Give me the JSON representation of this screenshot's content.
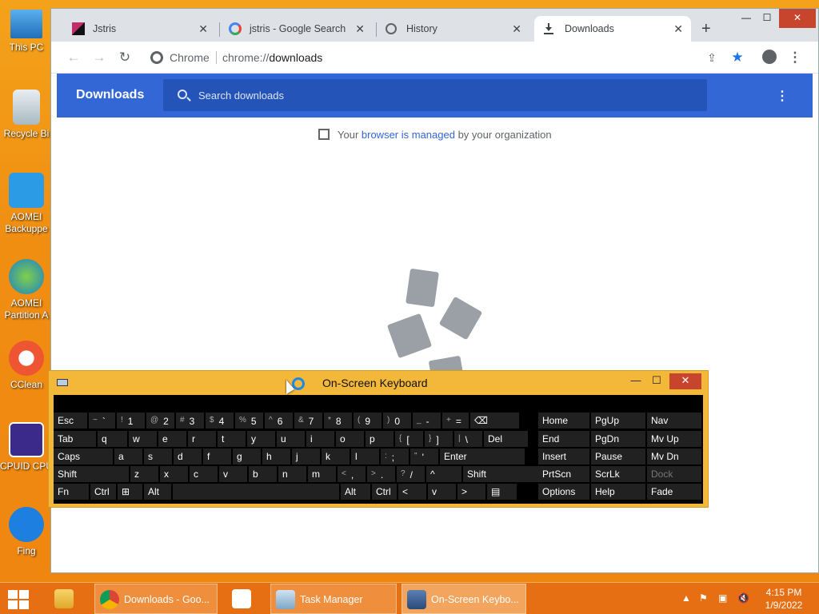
{
  "desktop": {
    "icons": [
      {
        "label": "This PC"
      },
      {
        "label": "Recycle Bi"
      },
      {
        "label": "AOMEI Backuppe"
      },
      {
        "label": "AOMEI Partition A"
      },
      {
        "label": "CClean"
      },
      {
        "label": "CPUID CPU"
      },
      {
        "label": "Fing"
      }
    ]
  },
  "browser": {
    "tabs": [
      {
        "title": "Jstris",
        "icon": "jstris-icon"
      },
      {
        "title": "jstris - Google Search",
        "icon": "google-icon"
      },
      {
        "title": "History",
        "icon": "history-icon"
      },
      {
        "title": "Downloads",
        "icon": "download-icon",
        "active": true
      }
    ],
    "new_tab": "+",
    "omnibox": {
      "site": "Chrome",
      "url_scheme": "chrome://",
      "url_path": "downloads"
    }
  },
  "downloads": {
    "title": "Downloads",
    "search_placeholder": "Search downloads",
    "managed_prefix": "Your ",
    "managed_link": "browser is managed",
    "managed_suffix": " by your organization"
  },
  "osk": {
    "title": "On-Screen Keyboard",
    "rows": [
      [
        [
          "",
          "Esc"
        ],
        [
          "~",
          "`"
        ],
        [
          "!",
          "1"
        ],
        [
          "@",
          "2"
        ],
        [
          "#",
          "3"
        ],
        [
          "$",
          "4"
        ],
        [
          "%",
          "5"
        ],
        [
          "^",
          "6"
        ],
        [
          "&",
          "7"
        ],
        [
          "*",
          "8"
        ],
        [
          "(",
          "9"
        ],
        [
          ")",
          "0"
        ],
        [
          "_",
          "-"
        ],
        [
          "+",
          "="
        ],
        [
          "",
          "⌫"
        ]
      ],
      [
        [
          "",
          "Tab"
        ],
        [
          "",
          "q"
        ],
        [
          "",
          "w"
        ],
        [
          "",
          "e"
        ],
        [
          "",
          "r"
        ],
        [
          "",
          "t"
        ],
        [
          "",
          "y"
        ],
        [
          "",
          "u"
        ],
        [
          "",
          "i"
        ],
        [
          "",
          "o"
        ],
        [
          "",
          "p"
        ],
        [
          "{",
          "["
        ],
        [
          "}",
          "]"
        ],
        [
          "|",
          "\\"
        ],
        [
          "",
          "Del"
        ]
      ],
      [
        [
          "",
          "Caps"
        ],
        [
          "",
          "a"
        ],
        [
          "",
          "s"
        ],
        [
          "",
          "d"
        ],
        [
          "",
          "f"
        ],
        [
          "",
          "g"
        ],
        [
          "",
          "h"
        ],
        [
          "",
          "j"
        ],
        [
          "",
          "k"
        ],
        [
          "",
          "l"
        ],
        [
          ":",
          ";"
        ],
        [
          "\"",
          "'"
        ],
        [
          "",
          "Enter"
        ]
      ],
      [
        [
          "",
          "Shift"
        ],
        [
          "",
          "z"
        ],
        [
          "",
          "x"
        ],
        [
          "",
          "c"
        ],
        [
          "",
          "v"
        ],
        [
          "",
          "b"
        ],
        [
          "",
          "n"
        ],
        [
          "",
          "m"
        ],
        [
          "<",
          ","
        ],
        [
          ">",
          "."
        ],
        [
          "?",
          "/"
        ],
        [
          "",
          "^"
        ],
        [
          "",
          "Shift"
        ]
      ],
      [
        [
          "",
          "Fn"
        ],
        [
          "",
          "Ctrl"
        ],
        [
          "",
          "⊞"
        ],
        [
          "",
          "Alt"
        ],
        [
          "",
          ""
        ],
        [
          "",
          "Alt"
        ],
        [
          "",
          "Ctrl"
        ],
        [
          "",
          "<"
        ],
        [
          "",
          "v"
        ],
        [
          "",
          ">"
        ],
        [
          "",
          "▤"
        ]
      ]
    ],
    "side": [
      [
        "Home",
        "PgUp",
        "Nav"
      ],
      [
        "End",
        "PgDn",
        "Mv Up"
      ],
      [
        "Insert",
        "Pause",
        "Mv Dn"
      ],
      [
        "PrtScn",
        "ScrLk",
        "Dock"
      ],
      [
        "Options",
        "Help",
        "Fade"
      ]
    ]
  },
  "taskbar": {
    "items": [
      {
        "label": "Downloads - Goo...",
        "icon": "chrome-icon"
      },
      {
        "label": "",
        "icon": "app-icon"
      },
      {
        "label": "Task Manager",
        "icon": "task-manager-icon"
      },
      {
        "label": "On-Screen Keybo...",
        "icon": "keyboard-icon"
      }
    ],
    "clock": {
      "time": "4:15 PM",
      "date": "1/9/2022"
    }
  }
}
